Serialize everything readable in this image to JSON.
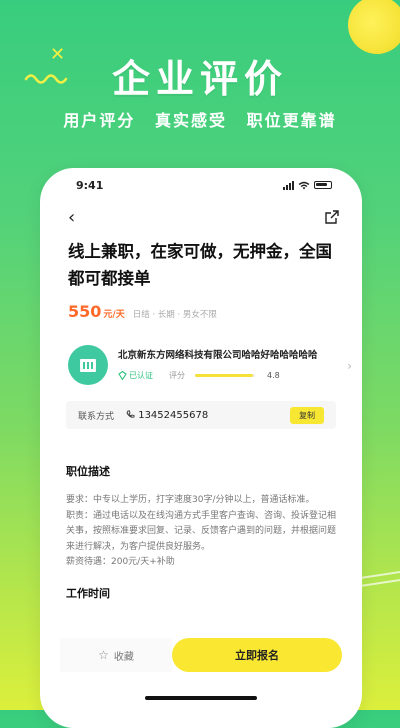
{
  "hero": {
    "title": "企业评价",
    "subtitle": [
      "用户评分",
      "真实感受",
      "职位更靠谱"
    ]
  },
  "status_bar": {
    "time": "9:41"
  },
  "job": {
    "title": "线上兼职，在家可做，无押金，全国都可都接单",
    "salary": "550",
    "salary_unit": "元/天",
    "tags": "日结 · 长期 · 男女不限"
  },
  "company": {
    "name": "北京新东方网络科技有限公司哈哈好哈哈哈哈哈",
    "verified": "已认证",
    "rating_label": "评分",
    "rating": 4.8,
    "rating_text": "4.8",
    "rating_max": 5
  },
  "contact": {
    "label": "联系方式",
    "phone": "13452455678",
    "copy_label": "复制"
  },
  "description": {
    "title": "职位描述",
    "lines": [
      "要求：中专以上学历，打字速度30字/分钟以上，普通话标准。",
      "职责：通过电话以及在线沟通方式手里客户查询、咨询、投诉登记相关事，按照标准要求回复、记录、反馈客户遇到的问题，并根据问题来进行解决，为客户提供良好服务。",
      "薪资待遇：200元/天+补助"
    ]
  },
  "work_time": {
    "title": "工作时间"
  },
  "actions": {
    "favorite": "收藏",
    "apply": "立即报名"
  },
  "colors": {
    "accent_yellow": "#f9e731",
    "salary_orange": "#ff6a2a",
    "logo_teal": "#3ec9a0"
  }
}
